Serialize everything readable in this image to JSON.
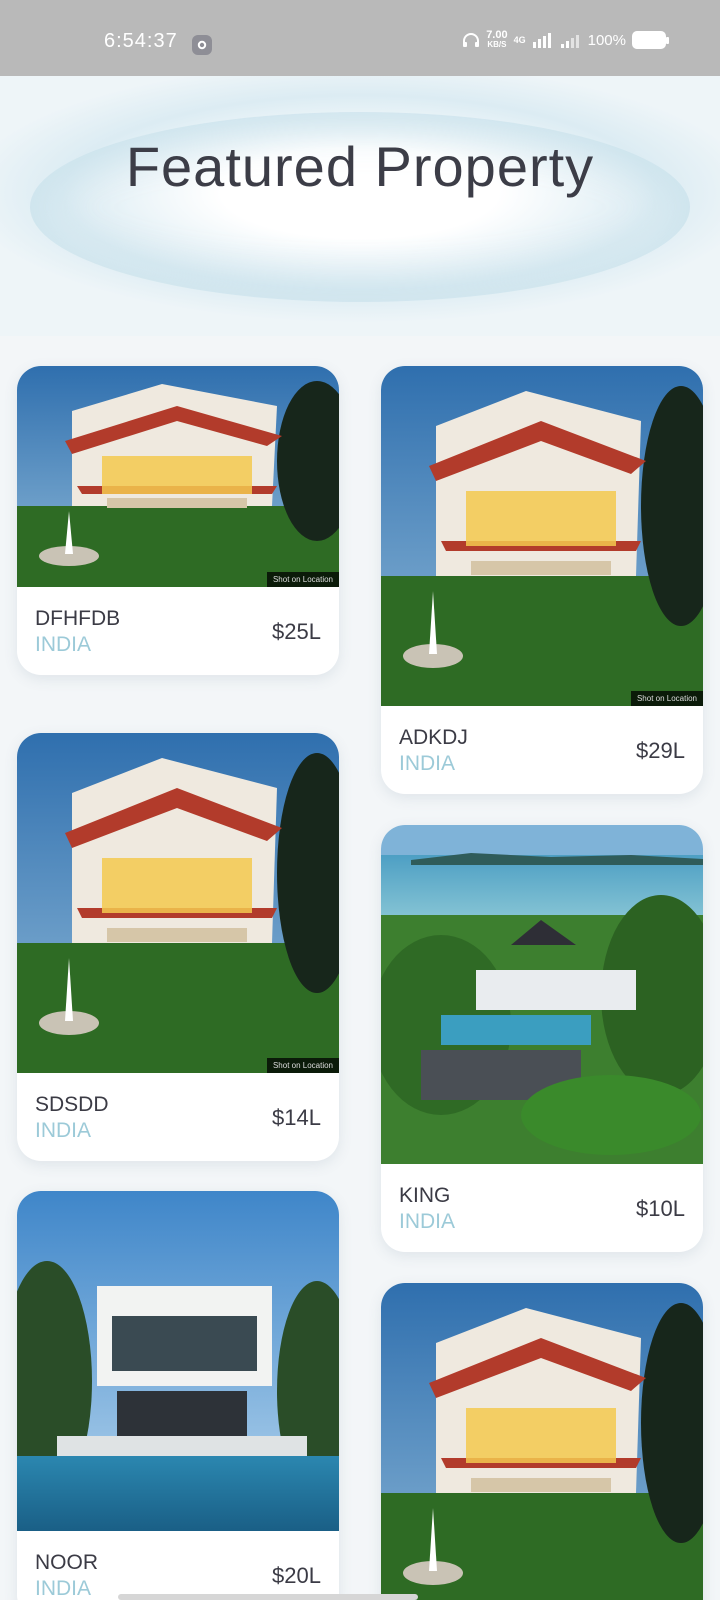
{
  "status_bar": {
    "time": "6:54:37",
    "speed_value": "7.00",
    "speed_unit": "KB/S",
    "network": "4G",
    "battery": "100%"
  },
  "page": {
    "title": "Featured Property"
  },
  "properties": [
    {
      "name": "DFHFDB",
      "country": "INDIA",
      "price": "$25L",
      "image": "villa-house-photo",
      "tag": "Shot on Location"
    },
    {
      "name": "ADKDJ",
      "country": "INDIA",
      "price": "$29L",
      "image": "villa-house-photo",
      "tag": "Shot on Location"
    },
    {
      "name": "SDSDD",
      "country": "INDIA",
      "price": "$14L",
      "image": "villa-house-photo",
      "tag": "Shot on Location"
    },
    {
      "name": "KING",
      "country": "INDIA",
      "price": "$10L",
      "image": "hillside-villa-photo"
    },
    {
      "name": "NOOR",
      "country": "INDIA",
      "price": "$20L",
      "image": "modern-pool-house-photo"
    },
    {
      "name": "",
      "country": "",
      "price": "",
      "image": "villa-house-photo"
    }
  ]
}
